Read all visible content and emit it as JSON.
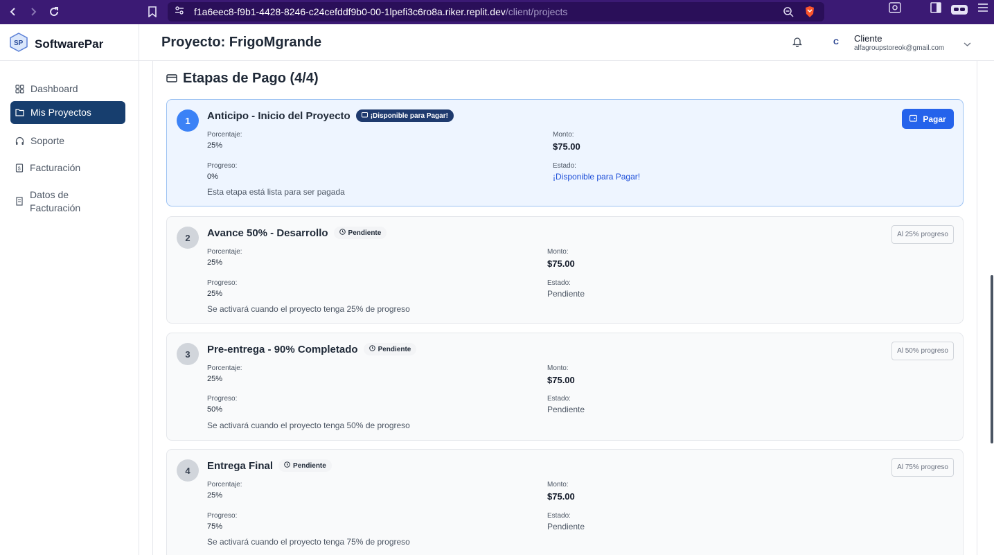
{
  "browser": {
    "url_host": "f1a6eec8-f9b1-4428-8246-c24cefddf9b0-00-1lpefi3c6ro8a.riker.replit.dev",
    "url_path": "/client/projects"
  },
  "app": {
    "brand": "SoftwarePar",
    "page_title": "Proyecto: FrigoMgrande",
    "user": {
      "initial": "C",
      "role": "Cliente",
      "email": "alfagroupstoreok@gmail.com"
    }
  },
  "sidebar": {
    "items": [
      {
        "label": "Dashboard",
        "icon": "grid-icon"
      },
      {
        "label": "Mis Proyectos",
        "icon": "folder-icon",
        "active": true
      },
      {
        "label": "Soporte",
        "icon": "headset-icon"
      },
      {
        "label": "Facturación",
        "icon": "receipt-icon"
      },
      {
        "label": "Datos de Facturación",
        "icon": "building-icon"
      }
    ]
  },
  "section": {
    "title": "Etapas de Pago (4/4)"
  },
  "labels": {
    "porcentaje": "Porcentaje:",
    "monto": "Monto:",
    "progreso": "Progreso:",
    "estado": "Estado:",
    "pay": "Pagar"
  },
  "stages": [
    {
      "num": "1",
      "title": "Anticipo - Inicio del Proyecto",
      "badge": "¡Disponible para Pagar!",
      "porcentaje": "25%",
      "monto": "$75.00",
      "progreso": "0%",
      "estado": "¡Disponible para Pagar!",
      "note": "Esta etapa está lista para ser pagada",
      "status_color": "#1d4ed8"
    },
    {
      "num": "2",
      "title": "Avance 50% - Desarrollo",
      "badge": "Pendiente",
      "porcentaje": "25%",
      "monto": "$75.00",
      "progreso": "25%",
      "estado": "Pendiente",
      "note": "Se activará cuando el proyecto tenga 25% de progreso",
      "tag": "Al 25% progreso"
    },
    {
      "num": "3",
      "title": "Pre-entrega - 90% Completado",
      "badge": "Pendiente",
      "porcentaje": "25%",
      "monto": "$75.00",
      "progreso": "50%",
      "estado": "Pendiente",
      "note": "Se activará cuando el proyecto tenga 50% de progreso",
      "tag": "Al 50% progreso"
    },
    {
      "num": "4",
      "title": "Entrega Final",
      "badge": "Pendiente",
      "porcentaje": "25%",
      "monto": "$75.00",
      "progreso": "75%",
      "estado": "Pendiente",
      "note": "Se activará cuando el proyecto tenga 75% de progreso",
      "tag": "Al 75% progreso"
    }
  ],
  "colors": {
    "browser_bar": "#3b1a74",
    "active_nav": "#173e6e",
    "primary_button": "#2563eb",
    "available_card_bg": "#eef5ff"
  }
}
